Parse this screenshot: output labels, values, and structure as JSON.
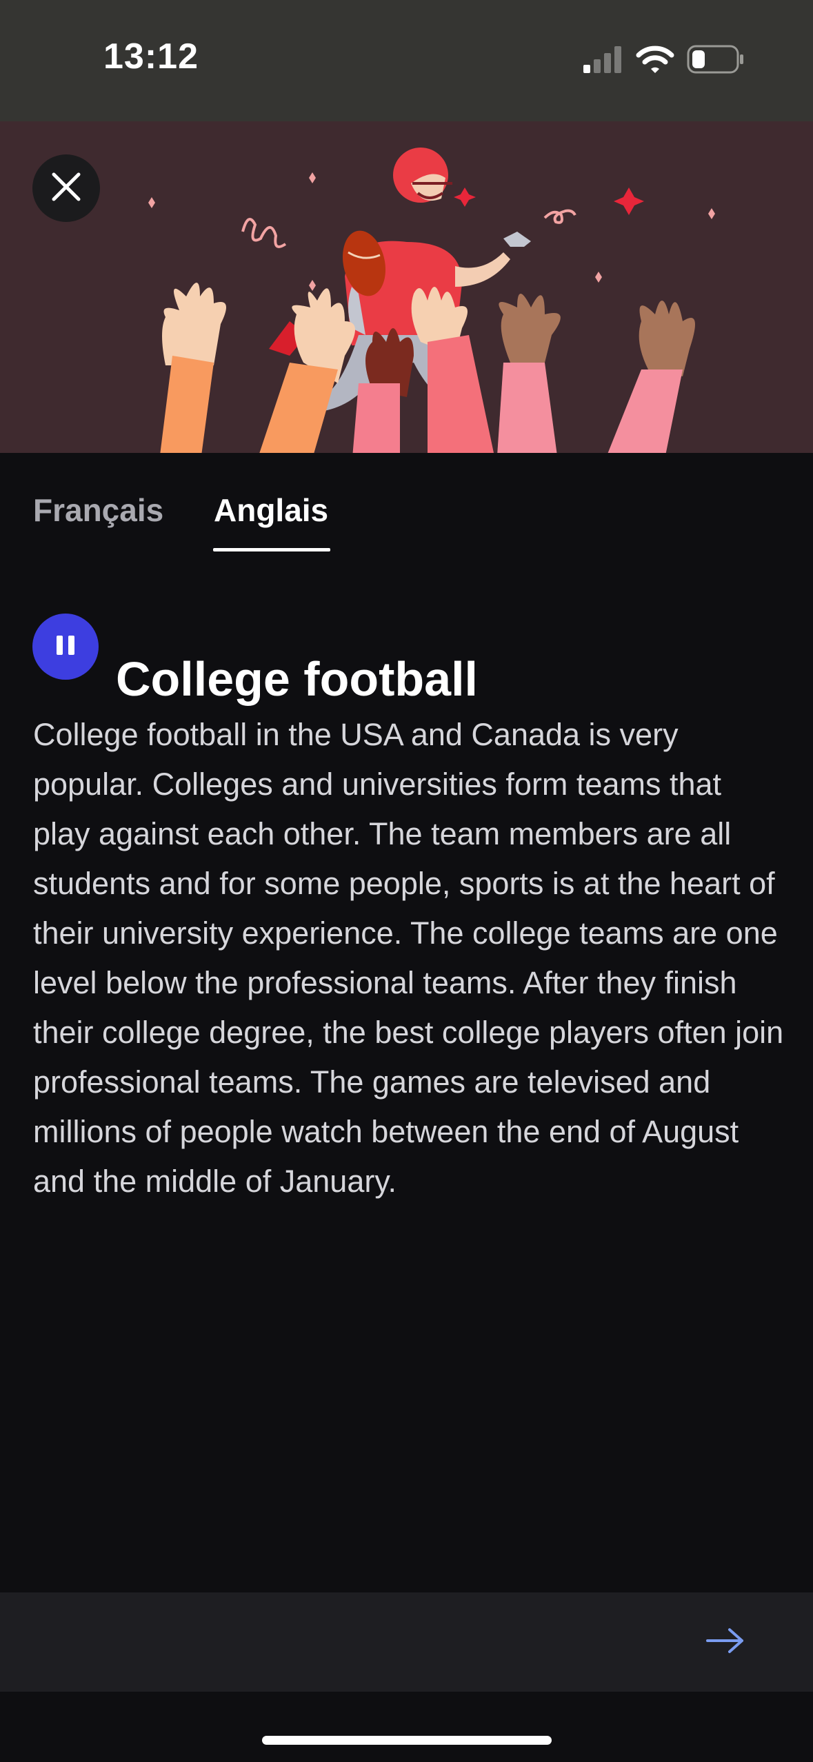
{
  "status_bar": {
    "time": "13:12",
    "icons": [
      "signal-icon",
      "wifi-icon",
      "battery-icon"
    ]
  },
  "hero": {
    "illustration": "college-football-player-illustration",
    "close_icon": "close-icon"
  },
  "tabs": [
    {
      "label": "Français",
      "active": false
    },
    {
      "label": "Anglais",
      "active": true
    }
  ],
  "lesson": {
    "title": "College football",
    "playback_icon": "pause-icon",
    "body": "College football in the USA and Canada is very popular. Colleges and universities form teams that play against each other. The team members are all students and for some people, sports is at the heart of their university experience. The college teams are one level below the professional teams. After they finish their college degree, the best college players often join professional teams. The games are televised and millions of people watch between the end of August and the middle of January."
  },
  "footer": {
    "next_icon": "arrow-right-icon"
  },
  "colors": {
    "background": "#0e0e11",
    "accent": "#3d3ee0",
    "hero_bg": "#3f2a2f",
    "next_arrow": "#7a9cf0"
  }
}
